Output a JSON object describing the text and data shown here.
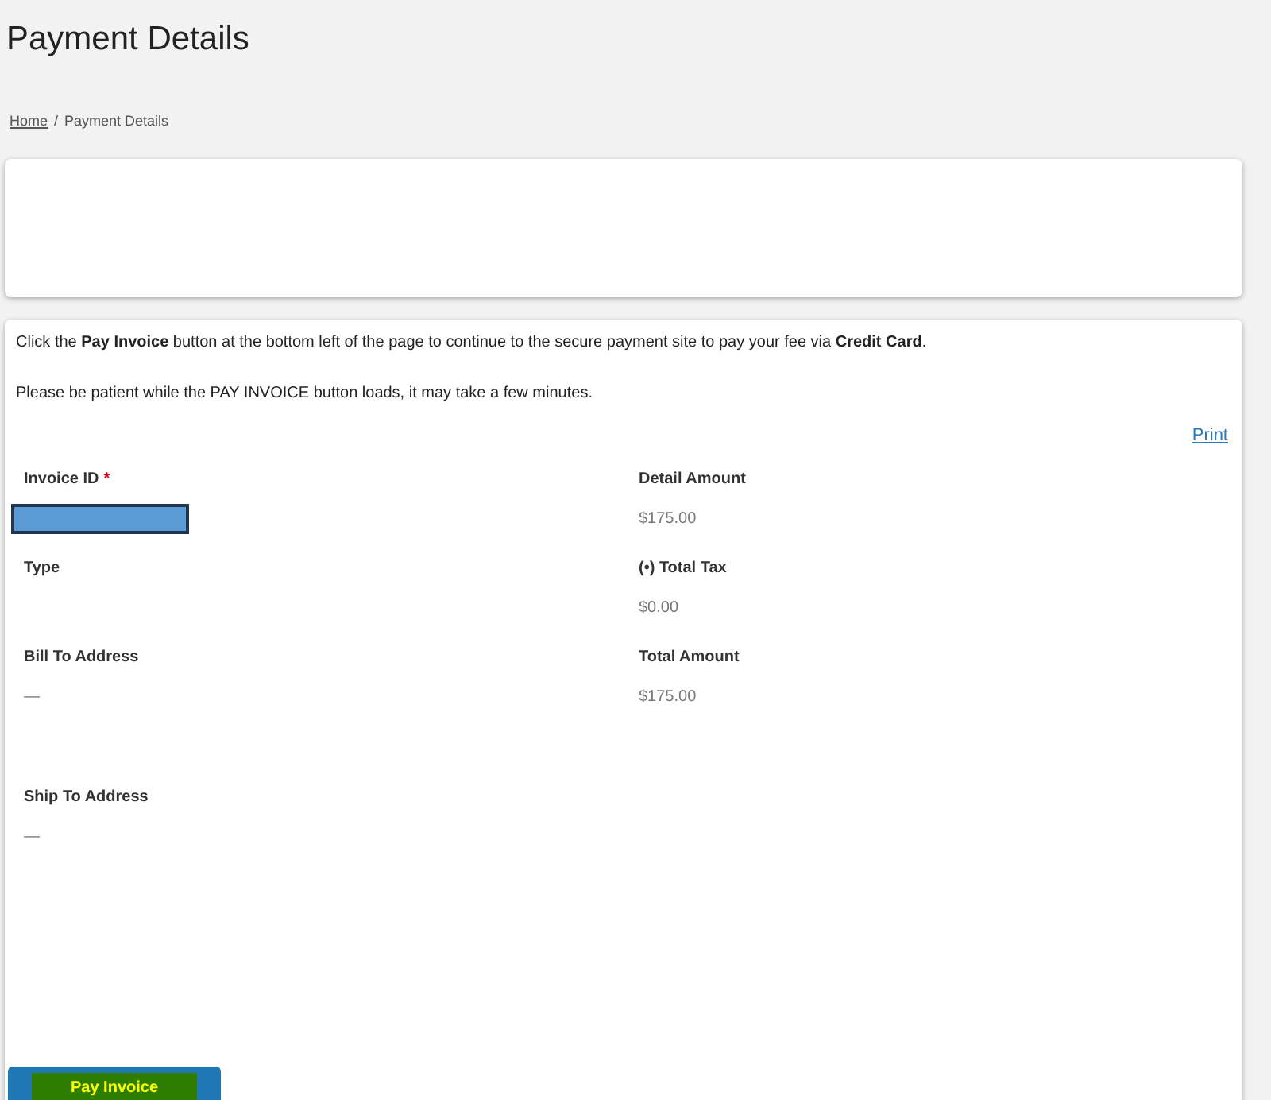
{
  "title": "Payment Details",
  "breadcrumb": {
    "home": "Home",
    "separator": "/",
    "current": "Payment Details"
  },
  "instructions": [
    "Click the **Pay Invoice** button at the bottom left of the page to continue to the secure payment site to pay your fee via **Credit Card**.",
    "Please be patient while the PAY INVOICE button loads, it may take a few minutes."
  ],
  "print_link": "Print",
  "left_fields": [
    {
      "label": "Invoice ID",
      "required_mark": "*",
      "kind": "input"
    },
    {
      "label": "Type",
      "kind": "text"
    },
    {
      "label": "Bill To Address",
      "kind": "text",
      "value": "—"
    },
    {
      "label": "Ship To Address",
      "kind": "text",
      "value": "—"
    }
  ],
  "right_fields": [
    {
      "label": "Detail Amount",
      "value": "$175.00"
    },
    {
      "label": "(•) Total Tax",
      "value": "$0.00"
    },
    {
      "label": "Total Amount",
      "value": "$175.00"
    }
  ],
  "pay_button": "Pay Invoice"
}
